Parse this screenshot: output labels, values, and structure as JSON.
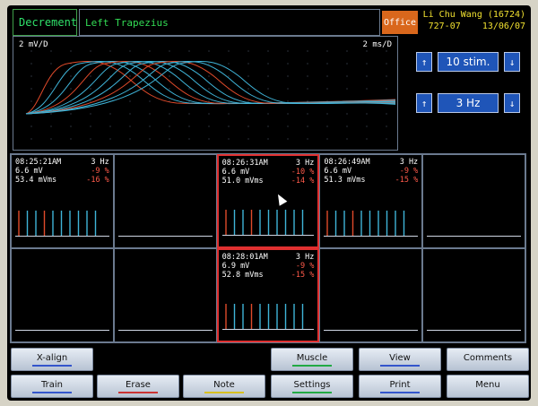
{
  "header": {
    "mode": "Decrement",
    "muscle": "Left Trapezius",
    "office": "Office",
    "patient_name": "Li Chu Wang (16724)",
    "patient_code": "727-07",
    "date": "13/06/07"
  },
  "wave": {
    "scale_v": "2 mV/D",
    "scale_h": "2 ms/D",
    "colors": {
      "red": "#e04a2a",
      "blue": "#3fb4d8"
    }
  },
  "controls": {
    "stim": {
      "value": "10 stim.",
      "up_icon": "up-arrow-icon",
      "down_icon": "down-arrow-icon"
    },
    "rate": {
      "value": "3 Hz"
    }
  },
  "cells": [
    {
      "time": "08:25:21AM",
      "rate": "3 Hz",
      "amp": "6.6 mV",
      "amp_pct": "-9 %",
      "area": "53.4 mVms",
      "area_pct": "-16 %",
      "spikes": true,
      "selected": false
    },
    {
      "spikes": false
    },
    {
      "time": "08:26:31AM",
      "rate": "3 Hz",
      "amp": "6.6 mV",
      "amp_pct": "-10 %",
      "area": "51.0 mVms",
      "area_pct": "-14 %",
      "spikes": true,
      "selected": true
    },
    {
      "time": "08:26:49AM",
      "rate": "3 Hz",
      "amp": "6.6 mV",
      "amp_pct": "-9 %",
      "area": "51.3 mVms",
      "area_pct": "-15 %",
      "spikes": true,
      "selected": false
    },
    {
      "spikes": false
    },
    {
      "spikes": false
    },
    {
      "spikes": false
    },
    {
      "time": "08:28:01AM",
      "rate": "3 Hz",
      "amp": "6.9 mV",
      "amp_pct": "-9 %",
      "area": "52.8 mVms",
      "area_pct": "-15 %",
      "spikes": true,
      "selected": true
    },
    {
      "spikes": false
    },
    {
      "spikes": false
    }
  ],
  "buttons": [
    {
      "label": "X-align",
      "underline": "#3355cc"
    },
    {
      "label": "Train",
      "underline": "#3355cc"
    },
    {
      "label": "Erase",
      "underline": "#cc3333"
    },
    {
      "label": "Note",
      "underline": "#d8c020"
    },
    {
      "label": "Muscle",
      "underline": "#22aa44"
    },
    {
      "label": "Settings",
      "underline": "#22aa44"
    },
    {
      "label": "View",
      "underline": "#3355cc"
    },
    {
      "label": "Print",
      "underline": "#3355cc"
    },
    {
      "label": "Comments",
      "underline": ""
    },
    {
      "label": "Menu",
      "underline": ""
    }
  ]
}
